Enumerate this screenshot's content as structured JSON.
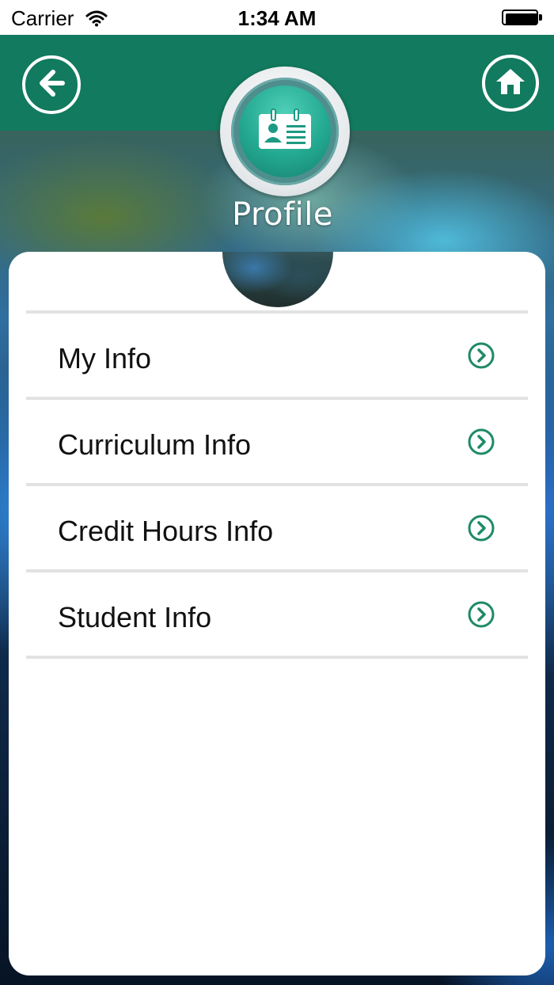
{
  "status_bar": {
    "carrier": "Carrier",
    "time": "1:34 AM",
    "wifi_icon": "wifi-icon",
    "battery_icon": "battery-icon"
  },
  "header": {
    "title": "Profile",
    "back_icon": "arrow-left-circle-icon",
    "home_icon": "home-circle-icon",
    "badge_icon": "id-card-icon",
    "brand_color": "#127a5e"
  },
  "menu": {
    "items": [
      {
        "label": "My Info",
        "icon": "chevron-right-circle-icon"
      },
      {
        "label": "Curriculum Info",
        "icon": "chevron-right-circle-icon"
      },
      {
        "label": "Credit Hours Info",
        "icon": "chevron-right-circle-icon"
      },
      {
        "label": "Student Info",
        "icon": "chevron-right-circle-icon"
      }
    ],
    "accent_color": "#1f8a67"
  }
}
